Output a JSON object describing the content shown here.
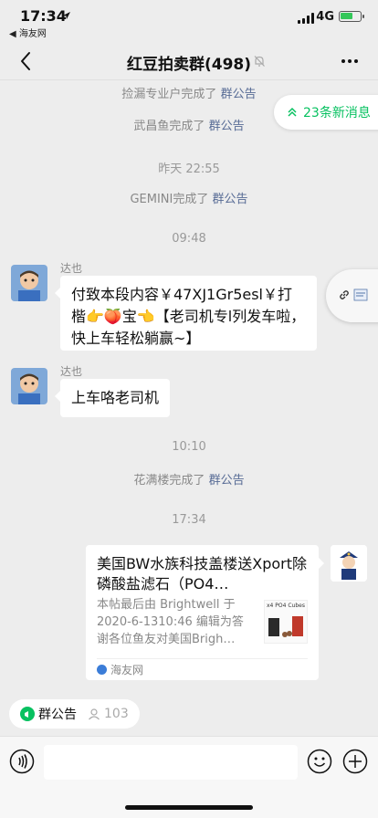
{
  "status": {
    "time": "17:34",
    "back_app": "◀ 海友网",
    "network": "4G"
  },
  "nav": {
    "title": "红豆拍卖群(498)"
  },
  "banner": {
    "new_messages": "23条新消息"
  },
  "system_messages": [
    {
      "name": "捡漏专业户",
      "verb": "完成了",
      "target": "群公告"
    },
    {
      "name": "武昌鱼",
      "verb": "完成了",
      "target": "群公告"
    },
    {
      "name": "GEMINI",
      "verb": "完成了",
      "target": "群公告"
    },
    {
      "name": "花满楼",
      "verb": "完成了",
      "target": "群公告"
    }
  ],
  "timestamps": [
    "昨天 22:55",
    "09:48",
    "10:10",
    "17:34"
  ],
  "messages": [
    {
      "sender": "达也",
      "text": "付致本段内容￥47XJ1Gr5esl￥打楷👉🍑宝👈【老司机专l列发车啦，快上车轻松躺赢~】"
    },
    {
      "sender": "达也",
      "text": "上车咯老司机"
    }
  ],
  "link_card": {
    "title": "美国BW水族科技盖楼送Xport除磷酸盐滤石（PO4…",
    "description": "本帖最后由 Brightwell 于 2020-6-1310:46 编辑为答谢各位鱼友对美国Brigh…",
    "thumb_label": "x4 PO4 Cubes",
    "source": "海友网"
  },
  "bottom": {
    "notice_label": "群公告",
    "member_count": "103"
  },
  "colors": {
    "accent": "#07c160",
    "link": "#576b95",
    "background": "#ededed"
  }
}
